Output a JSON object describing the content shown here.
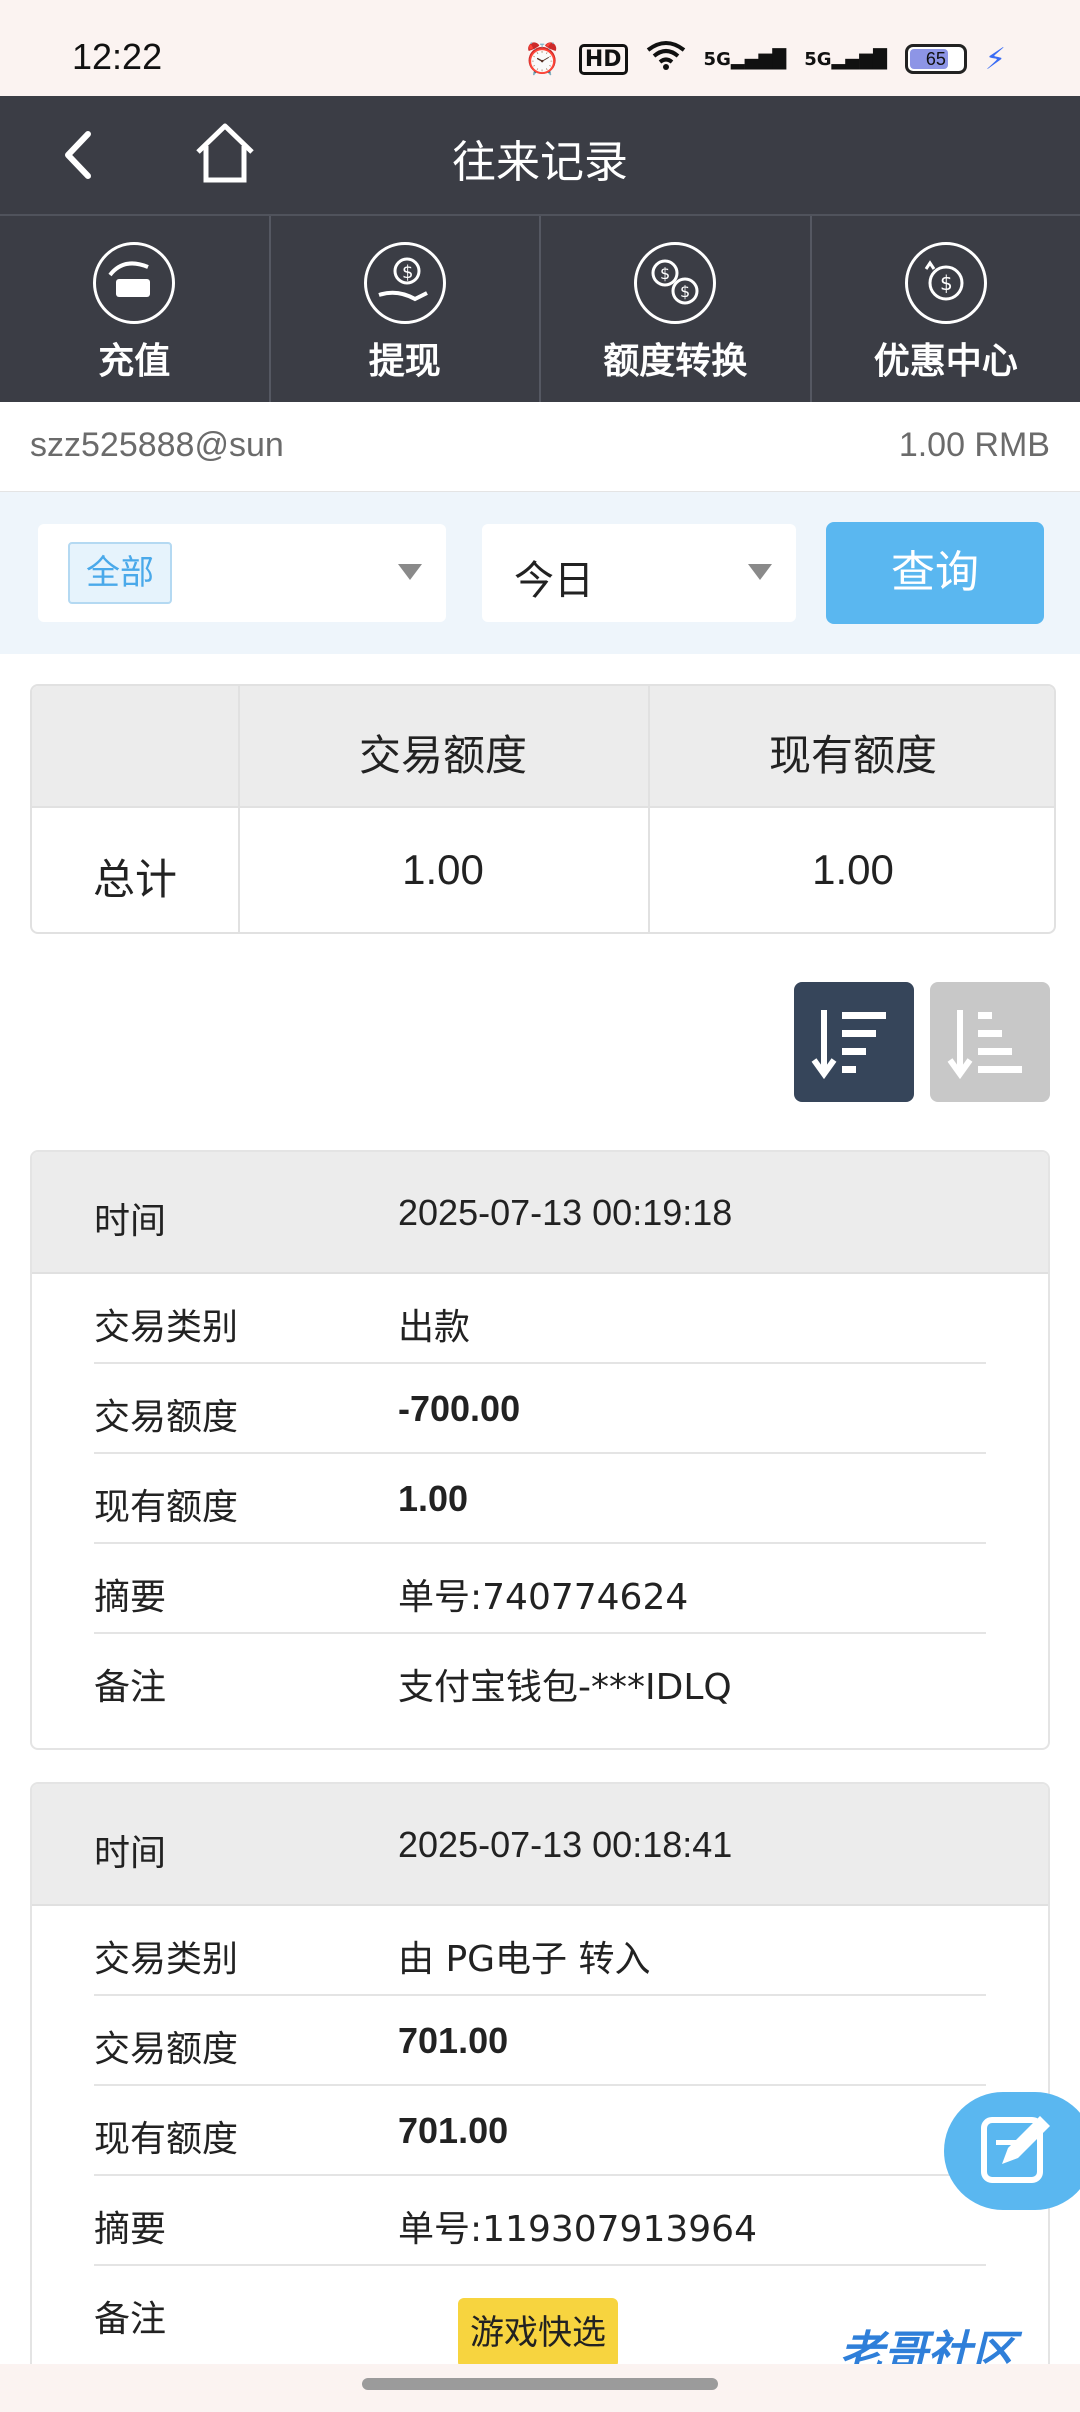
{
  "status_bar": {
    "time": "12:22",
    "hd_label": "HD",
    "net1": "5G",
    "net2": "5G",
    "battery": "65",
    "battery_level": 0.65
  },
  "header": {
    "title": "往来记录",
    "back_icon": "chevron-left-icon",
    "home_icon": "home-icon"
  },
  "quick_nav": [
    {
      "label": "充值",
      "icon": "deposit-icon"
    },
    {
      "label": "提现",
      "icon": "withdraw-icon"
    },
    {
      "label": "额度转换",
      "icon": "exchange-icon"
    },
    {
      "label": "优惠中心",
      "icon": "promo-icon"
    }
  ],
  "account": {
    "username": "szz525888@sun",
    "balance": "1.00 RMB"
  },
  "filter": {
    "type_value": "全部",
    "date_value": "今日",
    "query_label": "查询"
  },
  "totals": {
    "col1": "交易额度",
    "col2": "现有额度",
    "row_label": "总计",
    "trade": "1.00",
    "current": "1.00"
  },
  "records": [
    {
      "time_label": "时间",
      "time": "2025-07-13 00:19:18",
      "rows": [
        {
          "k": "交易类别",
          "v": "出款"
        },
        {
          "k": "交易额度",
          "v": "-700.00"
        },
        {
          "k": "现有额度",
          "v": "1.00"
        },
        {
          "k": "摘要",
          "v": "单号:740774624"
        },
        {
          "k": "备注",
          "v": "支付宝钱包-***IDLQ"
        }
      ]
    },
    {
      "time_label": "时间",
      "time": "2025-07-13 00:18:41",
      "rows": [
        {
          "k": "交易类别",
          "v": "由 PG电子 转入"
        },
        {
          "k": "交易额度",
          "v": "701.00"
        },
        {
          "k": "现有额度",
          "v": "701.00"
        },
        {
          "k": "摘要",
          "v": "单号:119307913964"
        },
        {
          "k": "备注",
          "v": ""
        }
      ]
    }
  ],
  "floating_badge": "游戏快选",
  "watermark": "老哥社区",
  "colors": {
    "header_bg": "#3b3d45",
    "accent": "#5ab7f0",
    "badge": "#f7d43f"
  }
}
